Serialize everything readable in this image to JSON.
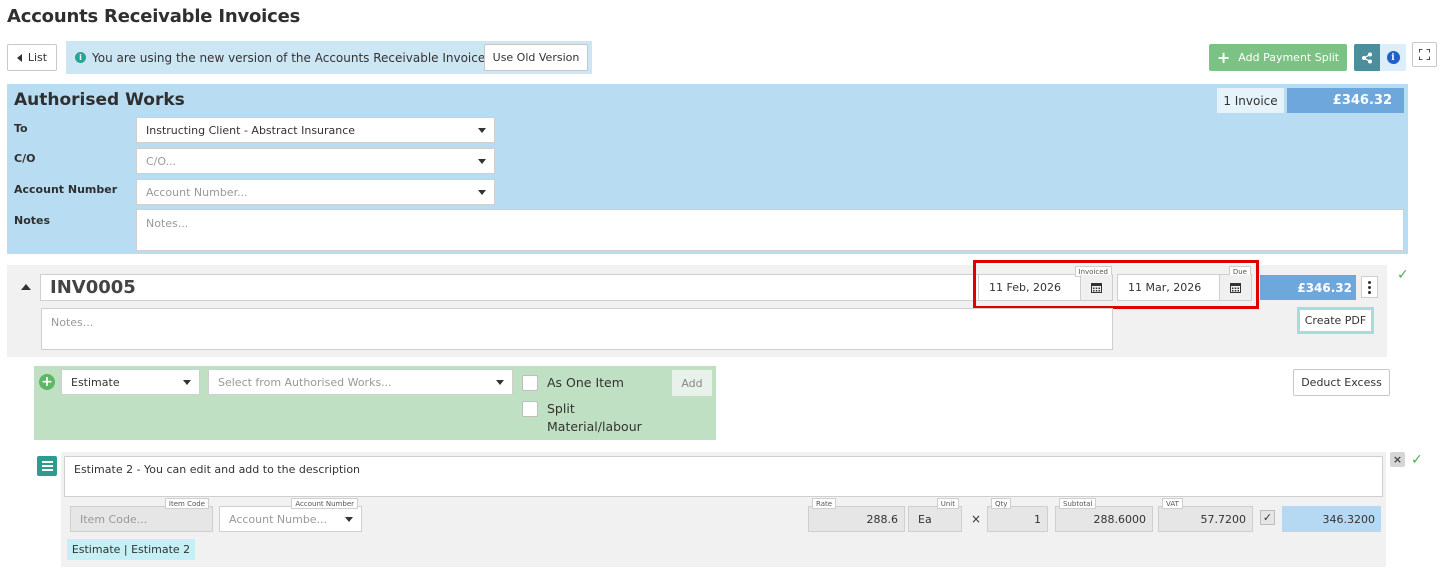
{
  "page_title": "Accounts Receivable Invoices",
  "top_bar": {
    "list_label": "List",
    "notice_text": "You are using the new version of the Accounts Receivable Invoices",
    "old_version_label": "Use Old Version",
    "add_payment_split_label": "Add Payment Split"
  },
  "authorised_works": {
    "title": "Authorised Works",
    "invoice_count": "1 Invoice",
    "total": "£346.32",
    "to_label": "To",
    "to_value": "Instructing Client - Abstract Insurance",
    "co_label": "C/O",
    "co_placeholder": "C/O...",
    "account_label": "Account Number",
    "account_placeholder": "Account Number...",
    "notes_label": "Notes",
    "notes_placeholder": "Notes..."
  },
  "invoice": {
    "number": "INV0005",
    "invoiced_label": "Invoiced",
    "invoiced_date": "11 Feb, 2026",
    "due_label": "Due",
    "due_date": "11 Mar, 2026",
    "amount": "£346.32",
    "notes_placeholder": "Notes...",
    "create_pdf_label": "Create PDF"
  },
  "add_line": {
    "type_value": "Estimate",
    "source_placeholder": "Select from Authorised Works...",
    "as_one_item_label": "As One Item",
    "split_label_1": "Split",
    "split_label_2": "Material/labour",
    "add_label": "Add",
    "deduct_excess_label": "Deduct Excess"
  },
  "line_item": {
    "description": "Estimate 2 - You can edit and add to the description",
    "item_code_label": "Item Code",
    "item_code_placeholder": "Item Code...",
    "account_number_label": "Account Number",
    "account_number_placeholder": "Account Numbe...",
    "rate_label": "Rate",
    "rate_value": "288.6",
    "unit_label": "Unit",
    "unit_value": "Ea",
    "times_symbol": "×",
    "qty_label": "Qty",
    "qty_value": "1",
    "subtotal_label": "Subtotal",
    "subtotal_value": "288.6000",
    "vat_label": "VAT",
    "vat_value": "57.7200",
    "total_value": "346.3200",
    "tag": "Estimate | Estimate 2"
  },
  "colors": {
    "panel_blue": "#b8dcf2",
    "total_blue": "#6ea7dc",
    "green_button": "#7dc285",
    "green_panel": "#bfe0c2",
    "highlight_red": "#e00000"
  }
}
